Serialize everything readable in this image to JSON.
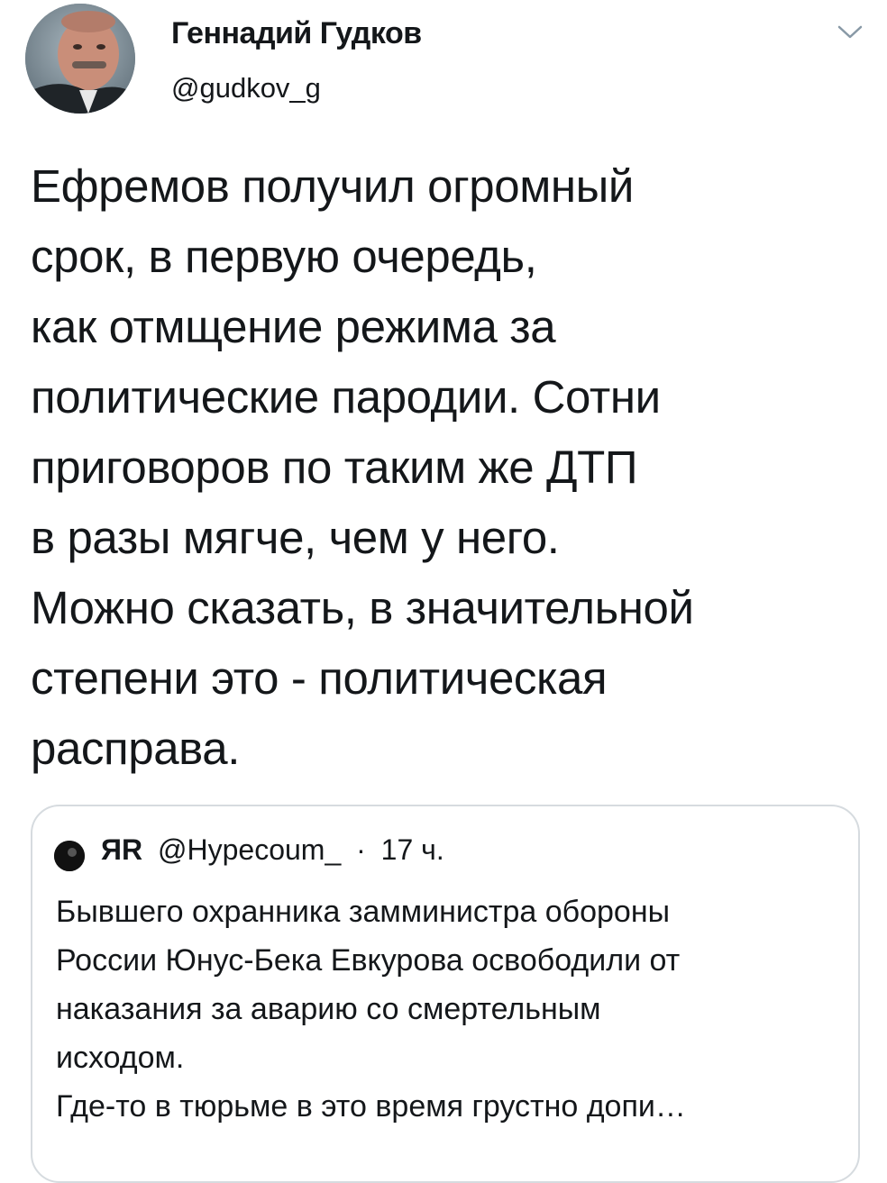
{
  "author": {
    "name": "Геннадий Гудков",
    "handle": "@gudkov_g"
  },
  "tweet_text_lines": [
    "Ефремов получил огромный",
    "срок, в первую очередь,",
    "как отмщение режима за",
    "политические пародии. Сотни",
    "приговоров по таким же ДТП",
    "в разы мягче, чем у него.",
    "Можно сказать, в значительной",
    "степени это - политическая",
    "расправа."
  ],
  "quoted_tweet": {
    "name": "ЯR",
    "handle": "@Hypecoum_",
    "separator": "·",
    "time": "17 ч.",
    "text_lines": [
      "Бывшего охранника замминистра обороны",
      "России Юнус-Бека Евкурова освободили от",
      "наказания за аварию со смертельным",
      "исходом.",
      "Где-то в тюрьме в это время грустно допи…"
    ]
  },
  "icons": {
    "menu": "chevron-down-icon",
    "avatar": "avatar",
    "quoted_avatar": "avatar"
  },
  "colors": {
    "text": "#14171a",
    "border": "#d6dbdf",
    "chevron": "#8899a6"
  }
}
